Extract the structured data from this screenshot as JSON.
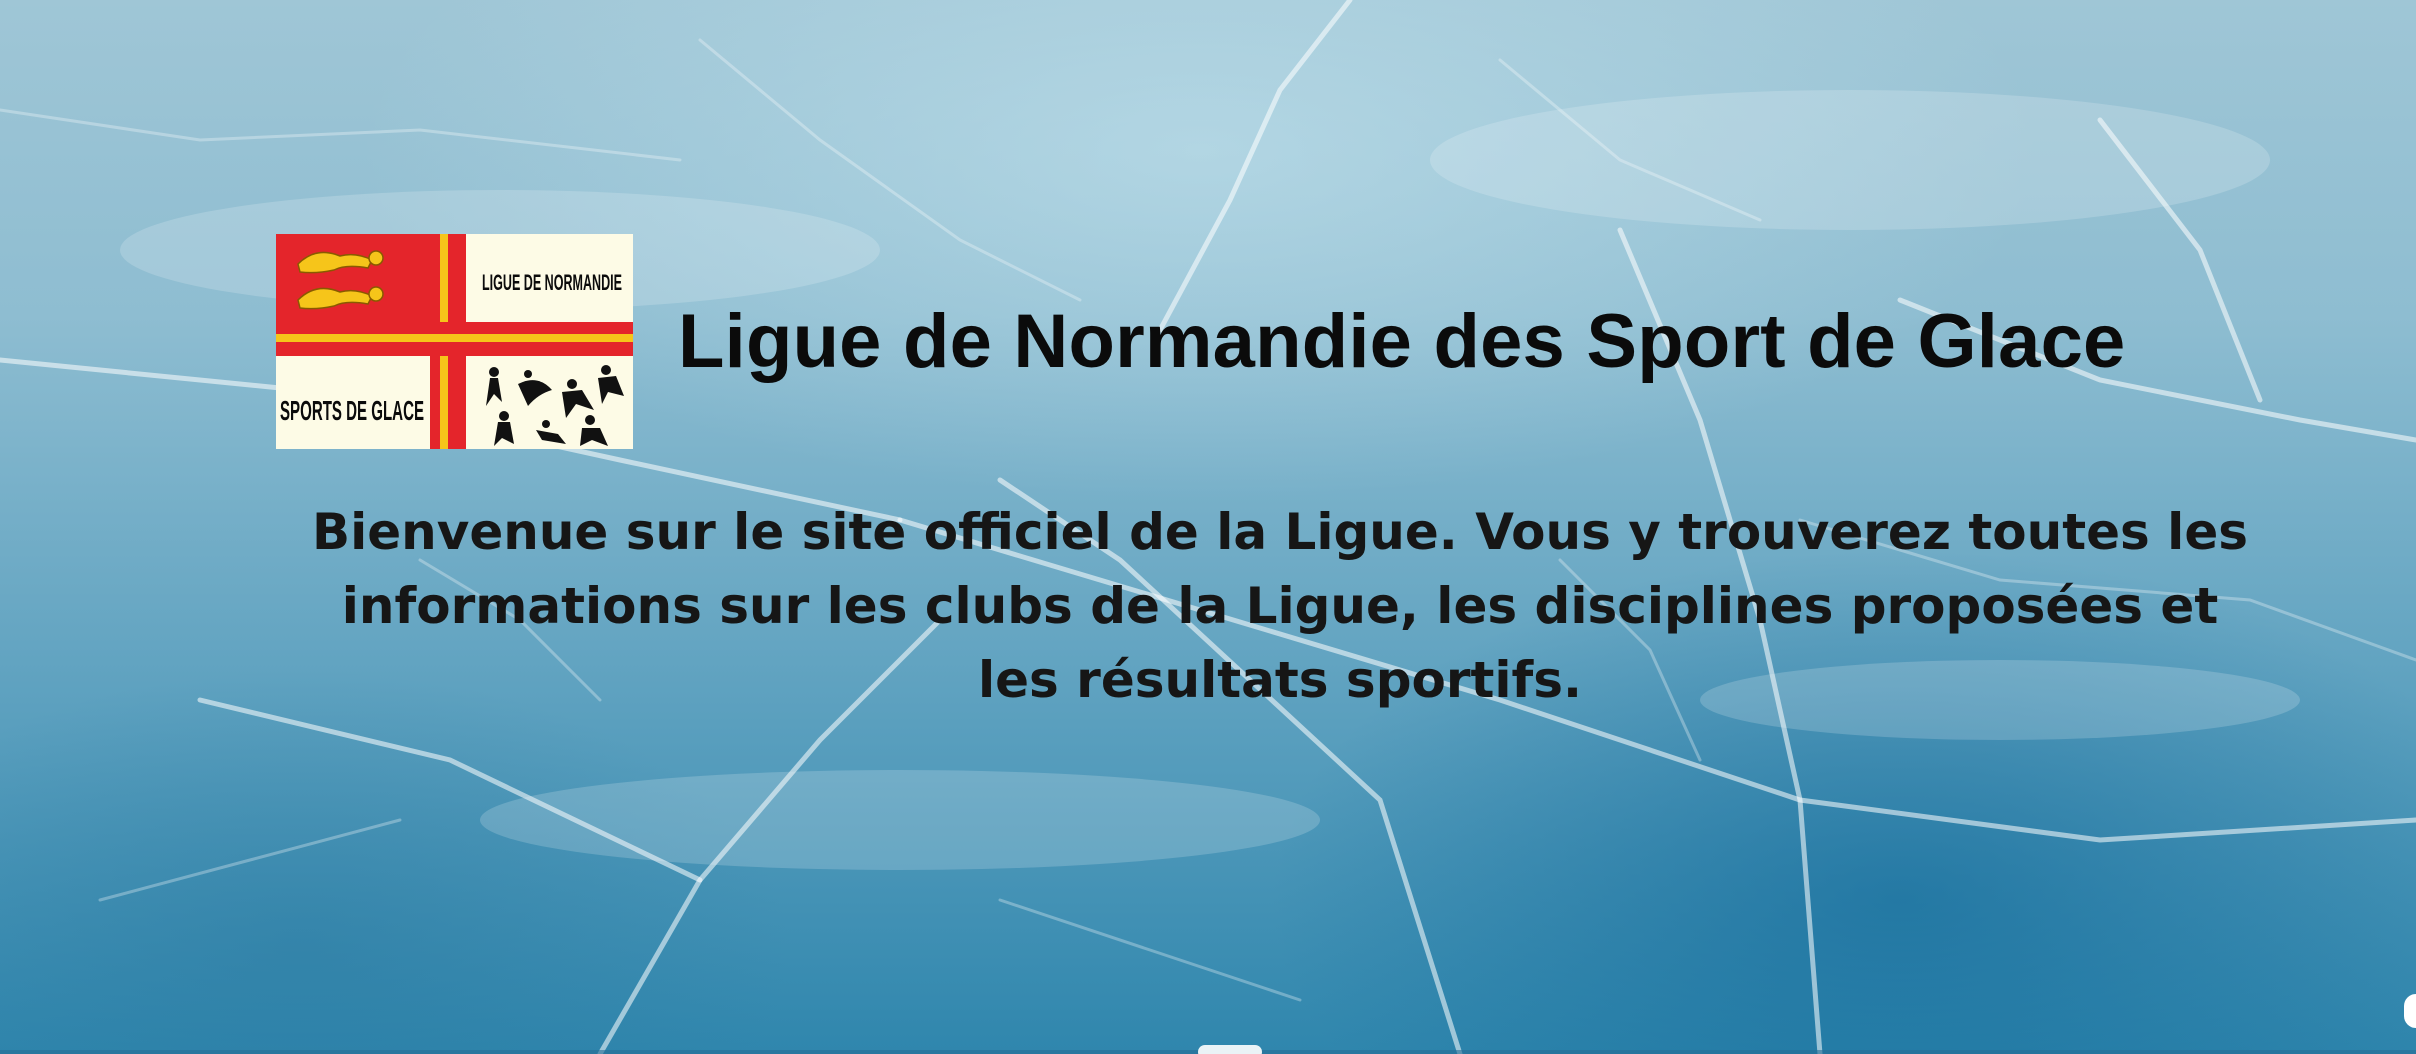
{
  "header": {
    "logo": {
      "alt": "Ligue de Normandie Sports de Glace",
      "text_top": "LIGUE DE NORMANDIE",
      "text_bottom": "SPORTS DE GLACE",
      "colors": {
        "red": "#e4252b",
        "yellow": "#f6c51a",
        "cream": "#fdfbe6"
      }
    },
    "title": "Ligue de Normandie des Sport de Glace"
  },
  "intro": {
    "text": "Bienvenue sur le site officiel de la Ligue. Vous y trouverez toutes les informations sur les clubs de la Ligue, les disciplines proposées et les résultats sportifs."
  },
  "background": {
    "description_icon": "frozen-ice-background"
  }
}
